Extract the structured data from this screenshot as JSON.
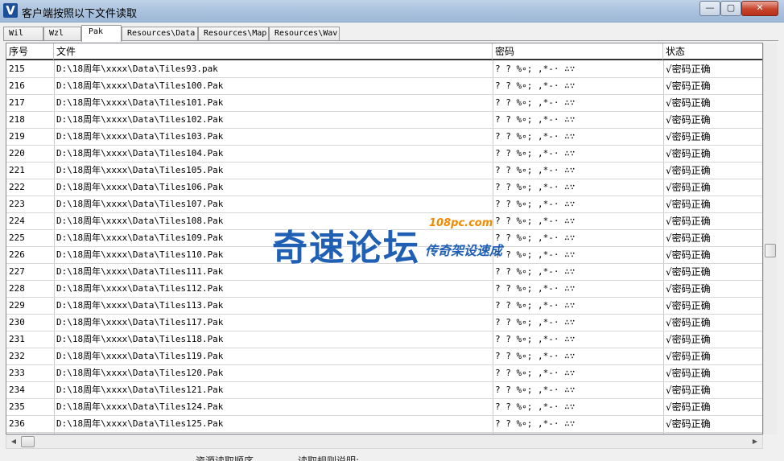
{
  "window": {
    "title": "客户端按照以下文件读取",
    "icon_letter": "V",
    "buttons": {
      "minimize": "—",
      "maximize": "▢",
      "close": "✕"
    }
  },
  "tabs": [
    {
      "label": "Wil",
      "active": false
    },
    {
      "label": "Wzl",
      "active": false
    },
    {
      "label": "Pak",
      "active": true
    },
    {
      "label": "Resources\\Data",
      "active": false
    },
    {
      "label": "Resources\\Map",
      "active": false
    },
    {
      "label": "Resources\\Wav",
      "active": false
    }
  ],
  "table": {
    "columns": [
      "序号",
      "文件",
      "密码",
      "状态"
    ],
    "rows": [
      {
        "idx": "215",
        "file": "D:\\18周年\\xxxx\\Data\\Tiles93.pak",
        "pwd": "? ? %∘; ,*-· ∴∵",
        "status": "√密码正确"
      },
      {
        "idx": "216",
        "file": "D:\\18周年\\xxxx\\Data\\Tiles100.Pak",
        "pwd": "? ? %∘; ,*-· ∴∵",
        "status": "√密码正确"
      },
      {
        "idx": "217",
        "file": "D:\\18周年\\xxxx\\Data\\Tiles101.Pak",
        "pwd": "? ? %∘; ,*-· ∴∵",
        "status": "√密码正确"
      },
      {
        "idx": "218",
        "file": "D:\\18周年\\xxxx\\Data\\Tiles102.Pak",
        "pwd": "? ? %∘; ,*-· ∴∵",
        "status": "√密码正确"
      },
      {
        "idx": "219",
        "file": "D:\\18周年\\xxxx\\Data\\Tiles103.Pak",
        "pwd": "? ? %∘; ,*-· ∴∵",
        "status": "√密码正确"
      },
      {
        "idx": "220",
        "file": "D:\\18周年\\xxxx\\Data\\Tiles104.Pak",
        "pwd": "? ? %∘; ,*-· ∴∵",
        "status": "√密码正确"
      },
      {
        "idx": "221",
        "file": "D:\\18周年\\xxxx\\Data\\Tiles105.Pak",
        "pwd": "? ? %∘; ,*-· ∴∵",
        "status": "√密码正确"
      },
      {
        "idx": "222",
        "file": "D:\\18周年\\xxxx\\Data\\Tiles106.Pak",
        "pwd": "? ? %∘; ,*-· ∴∵",
        "status": "√密码正确"
      },
      {
        "idx": "223",
        "file": "D:\\18周年\\xxxx\\Data\\Tiles107.Pak",
        "pwd": "? ? %∘; ,*-· ∴∵",
        "status": "√密码正确"
      },
      {
        "idx": "224",
        "file": "D:\\18周年\\xxxx\\Data\\Tiles108.Pak",
        "pwd": "? ? %∘; ,*-· ∴∵",
        "status": "√密码正确"
      },
      {
        "idx": "225",
        "file": "D:\\18周年\\xxxx\\Data\\Tiles109.Pak",
        "pwd": "? ? %∘; ,*-· ∴∵",
        "status": "√密码正确"
      },
      {
        "idx": "226",
        "file": "D:\\18周年\\xxxx\\Data\\Tiles110.Pak",
        "pwd": "? ? %∘; ,*-· ∴∵",
        "status": "√密码正确"
      },
      {
        "idx": "227",
        "file": "D:\\18周年\\xxxx\\Data\\Tiles111.Pak",
        "pwd": "? ? %∘; ,*-· ∴∵",
        "status": "√密码正确"
      },
      {
        "idx": "228",
        "file": "D:\\18周年\\xxxx\\Data\\Tiles112.Pak",
        "pwd": "? ? %∘; ,*-· ∴∵",
        "status": "√密码正确"
      },
      {
        "idx": "229",
        "file": "D:\\18周年\\xxxx\\Data\\Tiles113.Pak",
        "pwd": "? ? %∘; ,*-· ∴∵",
        "status": "√密码正确"
      },
      {
        "idx": "230",
        "file": "D:\\18周年\\xxxx\\Data\\Tiles117.Pak",
        "pwd": "? ? %∘; ,*-· ∴∵",
        "status": "√密码正确"
      },
      {
        "idx": "231",
        "file": "D:\\18周年\\xxxx\\Data\\Tiles118.Pak",
        "pwd": "? ? %∘; ,*-· ∴∵",
        "status": "√密码正确"
      },
      {
        "idx": "232",
        "file": "D:\\18周年\\xxxx\\Data\\Tiles119.Pak",
        "pwd": "? ? %∘; ,*-· ∴∵",
        "status": "√密码正确"
      },
      {
        "idx": "233",
        "file": "D:\\18周年\\xxxx\\Data\\Tiles120.Pak",
        "pwd": "? ? %∘; ,*-· ∴∵",
        "status": "√密码正确"
      },
      {
        "idx": "234",
        "file": "D:\\18周年\\xxxx\\Data\\Tiles121.Pak",
        "pwd": "? ? %∘; ,*-· ∴∵",
        "status": "√密码正确"
      },
      {
        "idx": "235",
        "file": "D:\\18周年\\xxxx\\Data\\Tiles124.Pak",
        "pwd": "? ? %∘; ,*-· ∴∵",
        "status": "√密码正确"
      },
      {
        "idx": "236",
        "file": "D:\\18周年\\xxxx\\Data\\Tiles125.Pak",
        "pwd": "? ? %∘; ,*-· ∴∵",
        "status": "√密码正确"
      }
    ]
  },
  "scrollbar": {
    "left_arrow": "◀",
    "right_arrow": "▶"
  },
  "bottom_labels": [
    "资源读取顺序",
    "读取规则说明:"
  ],
  "watermark": {
    "main": "奇速论坛",
    "url": "108pc.com",
    "sub": "传奇架设速成"
  }
}
